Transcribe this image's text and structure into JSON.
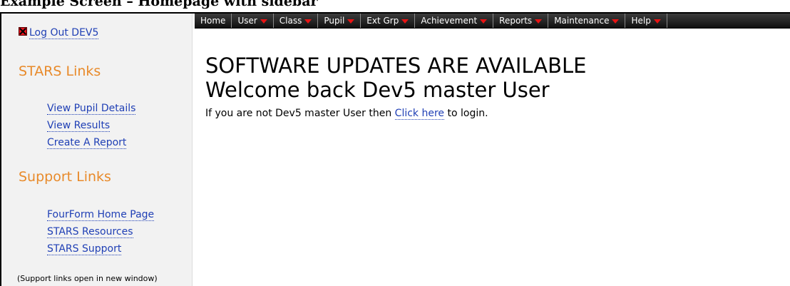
{
  "caption": "Example Screen – Homepage with sidebar",
  "sidebar": {
    "logout_label": "Log Out DEV5",
    "stars_title": "STARS Links",
    "stars_links": [
      "View Pupil Details",
      "View Results",
      "Create A Report"
    ],
    "support_title": "Support Links",
    "support_links": [
      "FourForm Home Page",
      "STARS Resources",
      "STARS Support"
    ],
    "note": "(Support links open in new window)"
  },
  "menu": [
    {
      "label": "Home",
      "dropdown": false
    },
    {
      "label": "User",
      "dropdown": true
    },
    {
      "label": "Class",
      "dropdown": true
    },
    {
      "label": "Pupil",
      "dropdown": true
    },
    {
      "label": "Ext Grp",
      "dropdown": true
    },
    {
      "label": "Achievement",
      "dropdown": true
    },
    {
      "label": "Reports",
      "dropdown": true
    },
    {
      "label": "Maintenance",
      "dropdown": true
    },
    {
      "label": "Help",
      "dropdown": true
    }
  ],
  "main": {
    "updates_heading": "SOFTWARE UPDATES ARE AVAILABLE",
    "welcome_heading": "Welcome back Dev5 master User",
    "info_prefix": "If you are not Dev5 master User then ",
    "info_link": "Click here",
    "info_suffix": " to login."
  },
  "colors": {
    "accent_orange": "#e88a2a",
    "link_blue": "#1f3fb5",
    "menu_caret": "#e81414"
  }
}
